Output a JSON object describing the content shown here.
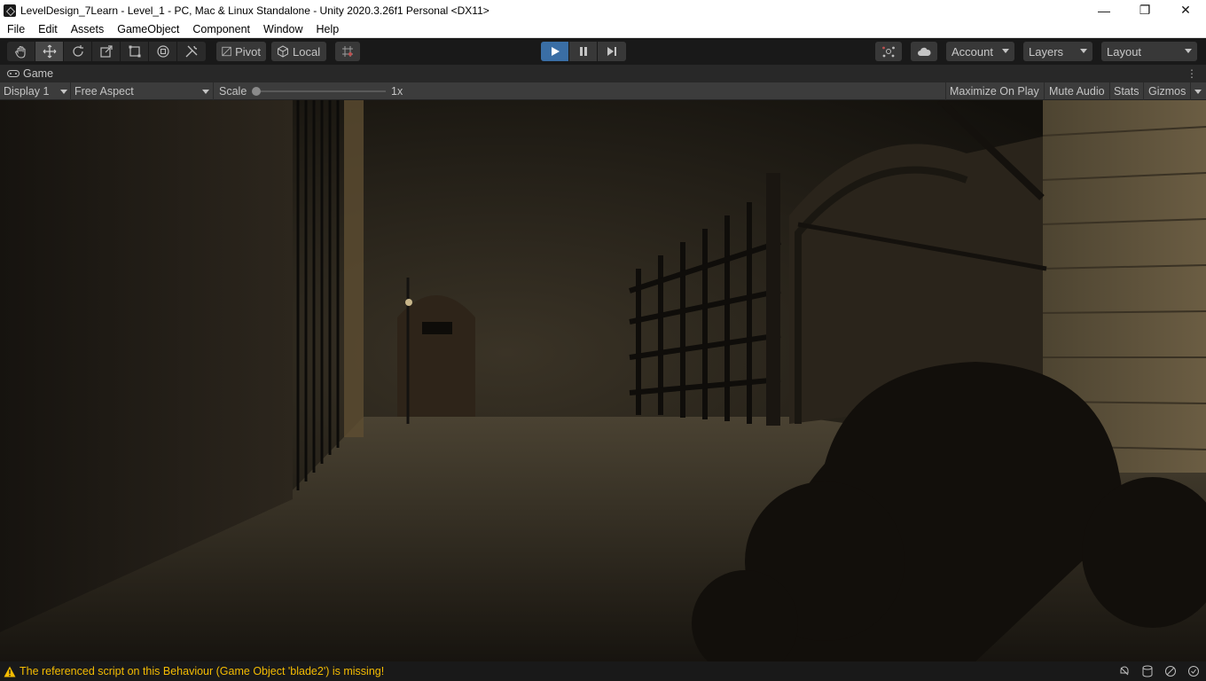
{
  "window": {
    "title": "LevelDesign_7Learn - Level_1 - PC, Mac & Linux Standalone - Unity 2020.3.26f1 Personal <DX11>",
    "minimize_glyph": "—",
    "maximize_glyph": "❐",
    "close_glyph": "✕"
  },
  "menu": [
    "File",
    "Edit",
    "Assets",
    "GameObject",
    "Component",
    "Window",
    "Help"
  ],
  "toolbar": {
    "tools": [
      {
        "name": "hand-tool",
        "icon": "hand-icon"
      },
      {
        "name": "move-tool",
        "icon": "move-icon",
        "active": true
      },
      {
        "name": "rotate-tool",
        "icon": "rotate-icon"
      },
      {
        "name": "scale-tool",
        "icon": "scale-icon"
      },
      {
        "name": "rect-tool",
        "icon": "rect-icon"
      },
      {
        "name": "transform-tool",
        "icon": "transform-icon"
      },
      {
        "name": "custom-tool",
        "icon": "tools-icon"
      }
    ],
    "pivot_label": "Pivot",
    "local_label": "Local",
    "account_label": "Account",
    "layers_label": "Layers",
    "layout_label": "Layout",
    "play_active_color": "#3a6ea5"
  },
  "game_tab": {
    "label": "Game"
  },
  "game_view": {
    "display_label": "Display 1",
    "aspect_label": "Free Aspect",
    "scale_label": "Scale",
    "scale_value": "1x",
    "scale_fraction": 0.0,
    "maximize_label": "Maximize On Play",
    "mute_label": "Mute Audio",
    "stats_label": "Stats",
    "gizmos_label": "Gizmos"
  },
  "status": {
    "message": "The referenced script on this Behaviour (Game Object 'blade2') is missing!",
    "warning_color": "#f4bc02"
  }
}
